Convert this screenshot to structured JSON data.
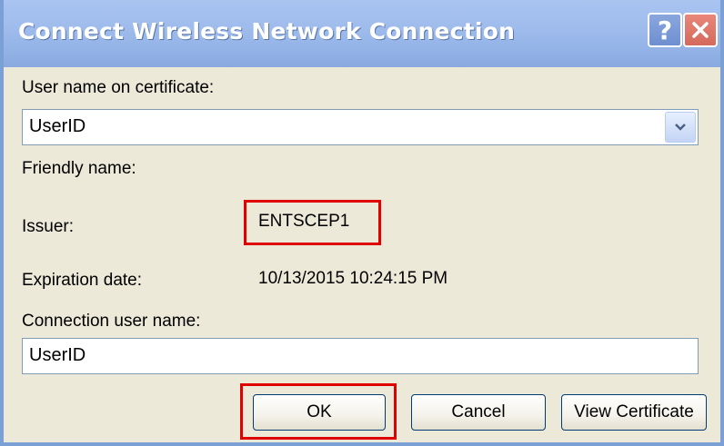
{
  "window": {
    "title": "Connect Wireless Network Connection",
    "help_label": "?",
    "close_icon": "close-icon"
  },
  "fields": {
    "user_name_on_certificate_label": "User name on certificate:",
    "user_name_on_certificate_value": "UserID",
    "friendly_name_label": "Friendly name:",
    "friendly_name_value": "",
    "issuer_label": "Issuer:",
    "issuer_value": "ENTSCEP1",
    "expiration_date_label": "Expiration date:",
    "expiration_date_value": "10/13/2015 10:24:15 PM",
    "connection_user_name_label": "Connection user name:",
    "connection_user_name_value": "UserID"
  },
  "buttons": {
    "ok": "OK",
    "cancel": "Cancel",
    "view_certificate": "View Certificate"
  },
  "colors": {
    "title_bar": "#9fbcec",
    "dialog_background": "#ece9d8",
    "highlight": "#e00000"
  }
}
